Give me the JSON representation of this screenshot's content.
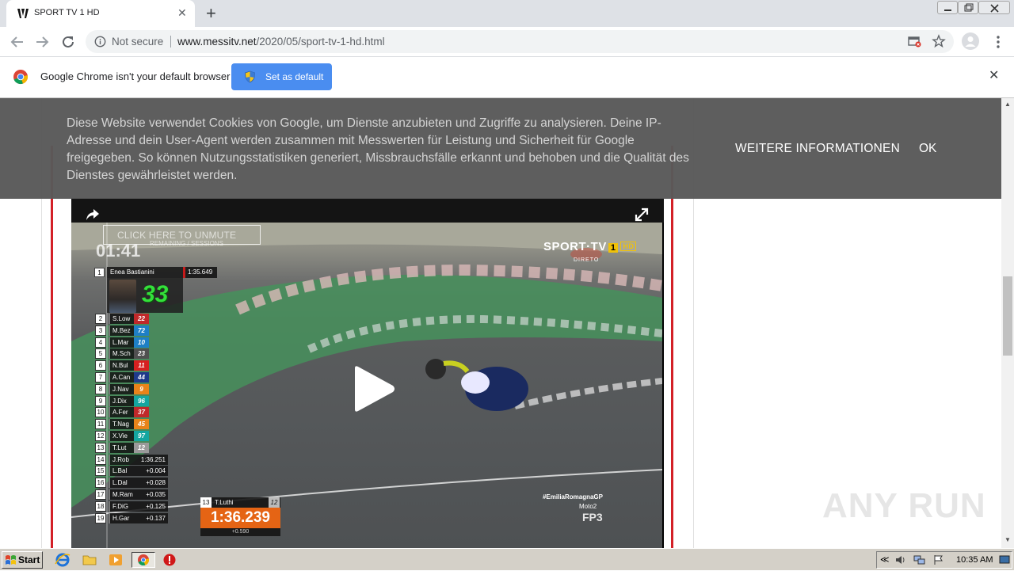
{
  "browser": {
    "tab_title": "SPORT TV 1 HD",
    "security_label": "Not secure",
    "url_host": "www.messitv.net",
    "url_path": "/2020/05/sport-tv-1-hd.html"
  },
  "infobar": {
    "message": "Google Chrome isn't your default browser",
    "button_label": "Set as default"
  },
  "cookie_banner": {
    "text": "Diese Website verwendet Cookies von Google, um Dienste anzubieten und Zugriffe zu analysieren. Deine IP-Adresse und dein User-Agent werden zusammen mit Messwerten für Leistung und Sicherheit für Google freigegeben. So können Nutzungsstatistiken generiert, Missbrauchsfälle erkannt und behoben und die Qualität des Dienstes gewährleistet werden.",
    "more_label": "WEITERE INFORMATIONEN",
    "ok_label": "OK"
  },
  "player": {
    "unmute_label": "CLICK HERE TO UNMUTE",
    "session_time": "01:41",
    "session_sub": "REMAINING / SESSIONS",
    "channel_name": "SPORT·TV",
    "channel_number": "1",
    "channel_hd": "HD",
    "channel_live": "DIRETO",
    "leader": {
      "pos": "1",
      "name": "Enea Bastianini",
      "time": "1:35.649",
      "number": "33"
    },
    "standings": [
      {
        "pos": "2",
        "name": "S.Low",
        "num": "22",
        "color": "#c0282a"
      },
      {
        "pos": "3",
        "name": "M.Bez",
        "num": "72",
        "color": "#1e7fc6"
      },
      {
        "pos": "4",
        "name": "L.Mar",
        "num": "10",
        "color": "#1e7fc6"
      },
      {
        "pos": "5",
        "name": "M.Sch",
        "num": "23",
        "color": "#505050"
      },
      {
        "pos": "6",
        "name": "N.Bul",
        "num": "11",
        "color": "#d62020"
      },
      {
        "pos": "7",
        "name": "A.Can",
        "num": "44",
        "color": "#1f3a8a"
      },
      {
        "pos": "8",
        "name": "J.Nav",
        "num": "9",
        "color": "#e8831a"
      },
      {
        "pos": "9",
        "name": "J.Dix",
        "num": "96",
        "color": "#14a6a0"
      },
      {
        "pos": "10",
        "name": "A.Fer",
        "num": "37",
        "color": "#c0282a"
      },
      {
        "pos": "11",
        "name": "T.Nag",
        "num": "45",
        "color": "#e8831a"
      },
      {
        "pos": "12",
        "name": "X.Vie",
        "num": "97",
        "color": "#14a6a0"
      },
      {
        "pos": "13",
        "name": "T.Lut",
        "num": "12",
        "color": "#9a9a9a"
      }
    ],
    "gaps": [
      {
        "pos": "14",
        "name": "J.Rob",
        "gap": "1:36.251"
      },
      {
        "pos": "15",
        "name": "L.Bal",
        "gap": "+0.004"
      },
      {
        "pos": "16",
        "name": "L.Dal",
        "gap": "+0.028"
      },
      {
        "pos": "17",
        "name": "M.Ram",
        "gap": "+0.035"
      },
      {
        "pos": "18",
        "name": "F.DiG",
        "gap": "+0.125"
      },
      {
        "pos": "19",
        "name": "H.Gar",
        "gap": "+0.137"
      }
    ],
    "lap": {
      "pos": "13",
      "name": "T.Luthi",
      "num": "12",
      "time": "1:36.239",
      "delta": "+0.590"
    },
    "event_tag": "#EmiliaRomagnaGP",
    "event_class": "Moto2",
    "event_session": "FP3"
  },
  "watermark": "ANY RUN",
  "taskbar": {
    "start_label": "Start",
    "clock": "10:35 AM"
  },
  "colors": {
    "accent_red": "#d32027",
    "lap_orange": "#e56414",
    "leader_green": "#33e03a"
  }
}
